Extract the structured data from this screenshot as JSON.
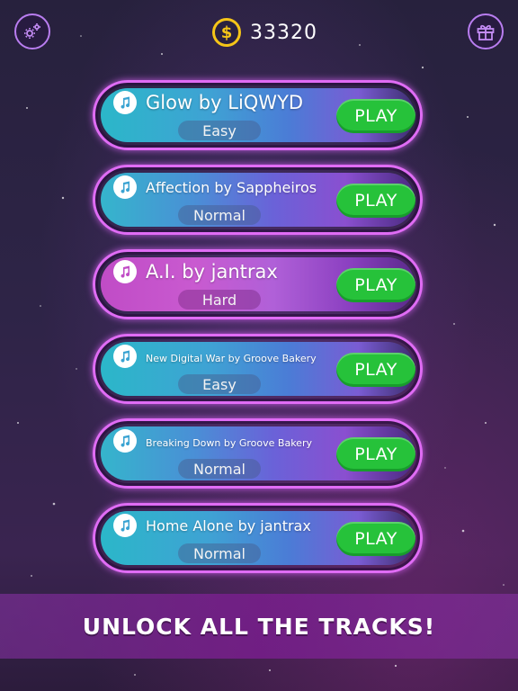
{
  "header": {
    "coins": "33320",
    "coin_symbol": "$",
    "settings_icon": "gear-icon",
    "gift_icon": "gift-icon"
  },
  "tracks": [
    {
      "title": "Glow by LiQWYD",
      "difficulty": "Easy",
      "play_label": "PLAY"
    },
    {
      "title": "Affection by Sappheiros",
      "difficulty": "Normal",
      "play_label": "PLAY"
    },
    {
      "title": "A.I. by jantrax",
      "difficulty": "Hard",
      "play_label": "PLAY"
    },
    {
      "title": "New Digital War by Groove Bakery",
      "difficulty": "Easy",
      "play_label": "PLAY"
    },
    {
      "title": "Breaking Down by Groove Bakery",
      "difficulty": "Normal",
      "play_label": "PLAY"
    },
    {
      "title": "Home Alone by jantrax",
      "difficulty": "Normal",
      "play_label": "PLAY"
    }
  ],
  "promo": {
    "label": "UNLOCK ALL THE TRACKS!"
  },
  "colors": {
    "accent_border": "#e06cf5",
    "play_green": "#26c23a",
    "coin_gold": "#f5c518"
  }
}
